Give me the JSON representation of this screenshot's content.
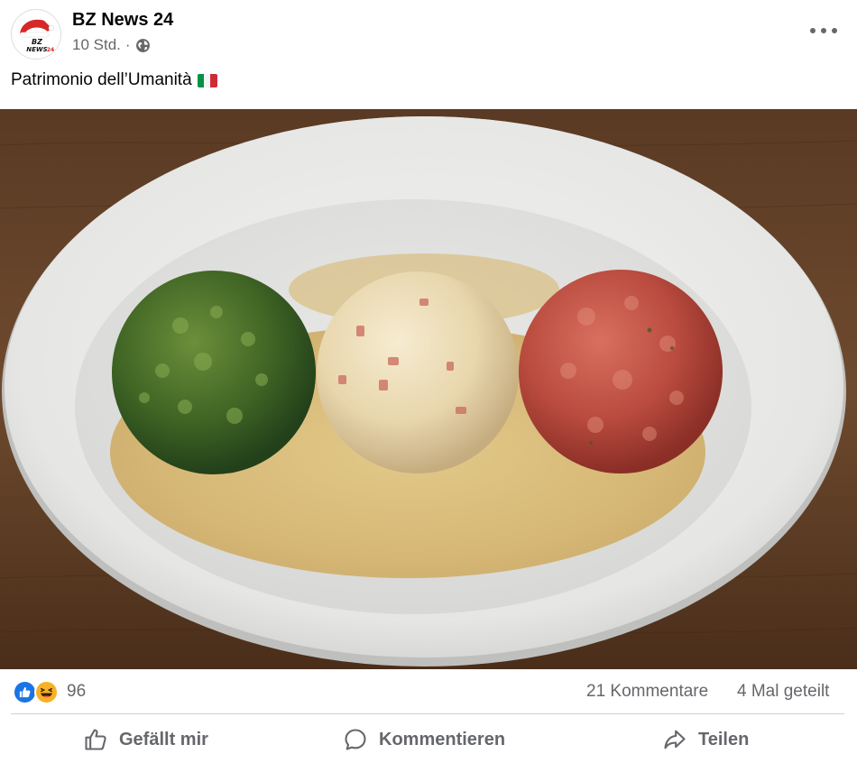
{
  "post": {
    "page_name": "BZ News 24",
    "time": "10 Std.",
    "separator": "·",
    "privacy_icon": "globe-icon",
    "caption": "Patrimonio dell’Umanità",
    "caption_emoji": "italy-flag",
    "avatar_text": "BZ NEWS 24",
    "more_icon": "more-options-icon"
  },
  "engagement": {
    "reactions": [
      "like",
      "haha"
    ],
    "reaction_count": "96",
    "comments": "21 Kommentare",
    "shares": "4 Mal geteilt"
  },
  "actions": {
    "like_label": "Gefällt mir",
    "comment_label": "Kommentieren",
    "share_label": "Teilen"
  },
  "colors": {
    "like_blue": "#1b74e4",
    "muted_text": "#65676b",
    "flag_green": "#009246",
    "flag_white": "#ffffff",
    "flag_red": "#ce2b37"
  }
}
